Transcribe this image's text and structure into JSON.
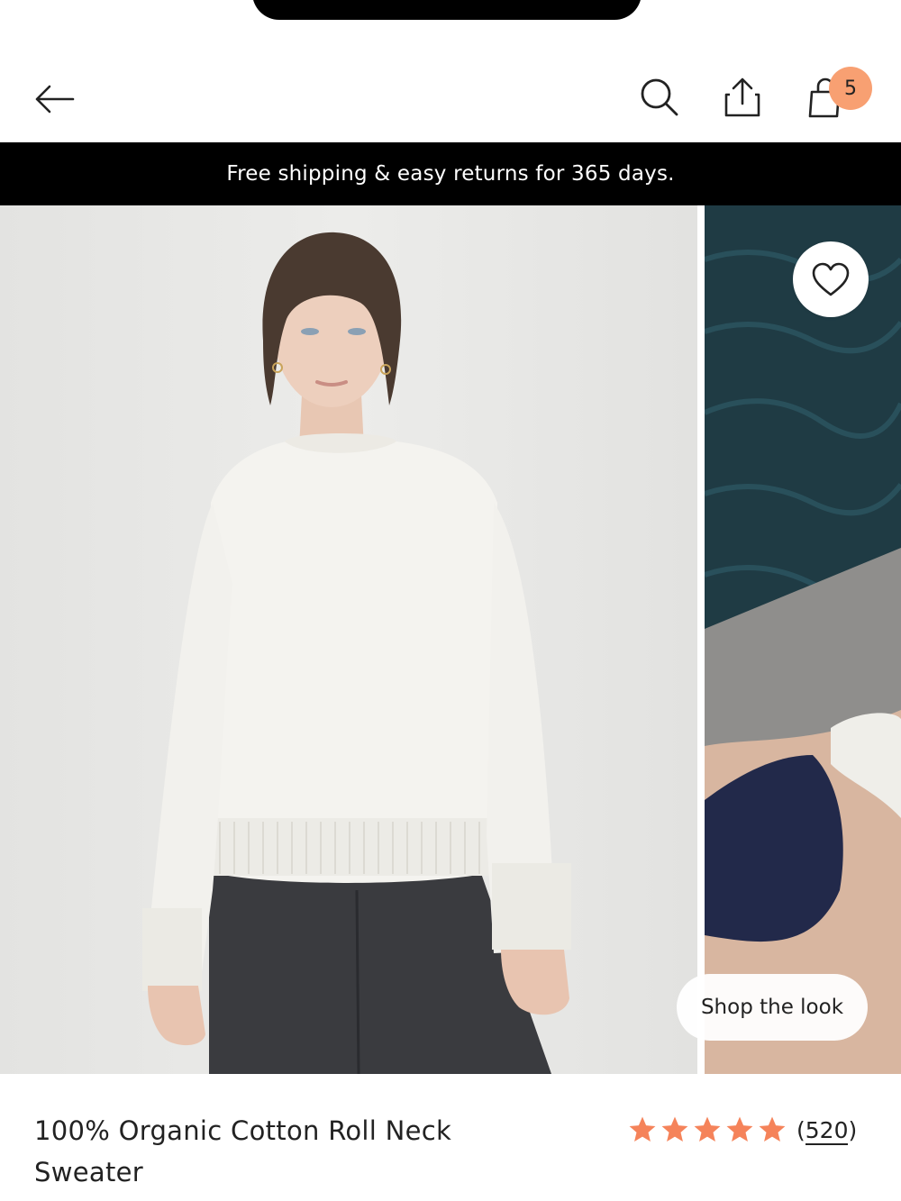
{
  "header": {
    "back_icon": "arrow-left-icon",
    "search_icon": "search-icon",
    "share_icon": "share-icon",
    "bag_icon": "shopping-bag-icon",
    "bag_count": "5",
    "badge_color": "#f8a072"
  },
  "promo": {
    "text": "Free shipping & easy returns for 365 days."
  },
  "gallery": {
    "favorite_icon": "heart-icon",
    "shop_the_look_label": "Shop the look"
  },
  "product": {
    "title": "100% Organic Cotton Roll Neck Sweater",
    "rating": 5,
    "rating_max": 5,
    "review_count_open": "(",
    "review_count": "520",
    "review_count_close": ")",
    "star_color": "#f5835a"
  }
}
